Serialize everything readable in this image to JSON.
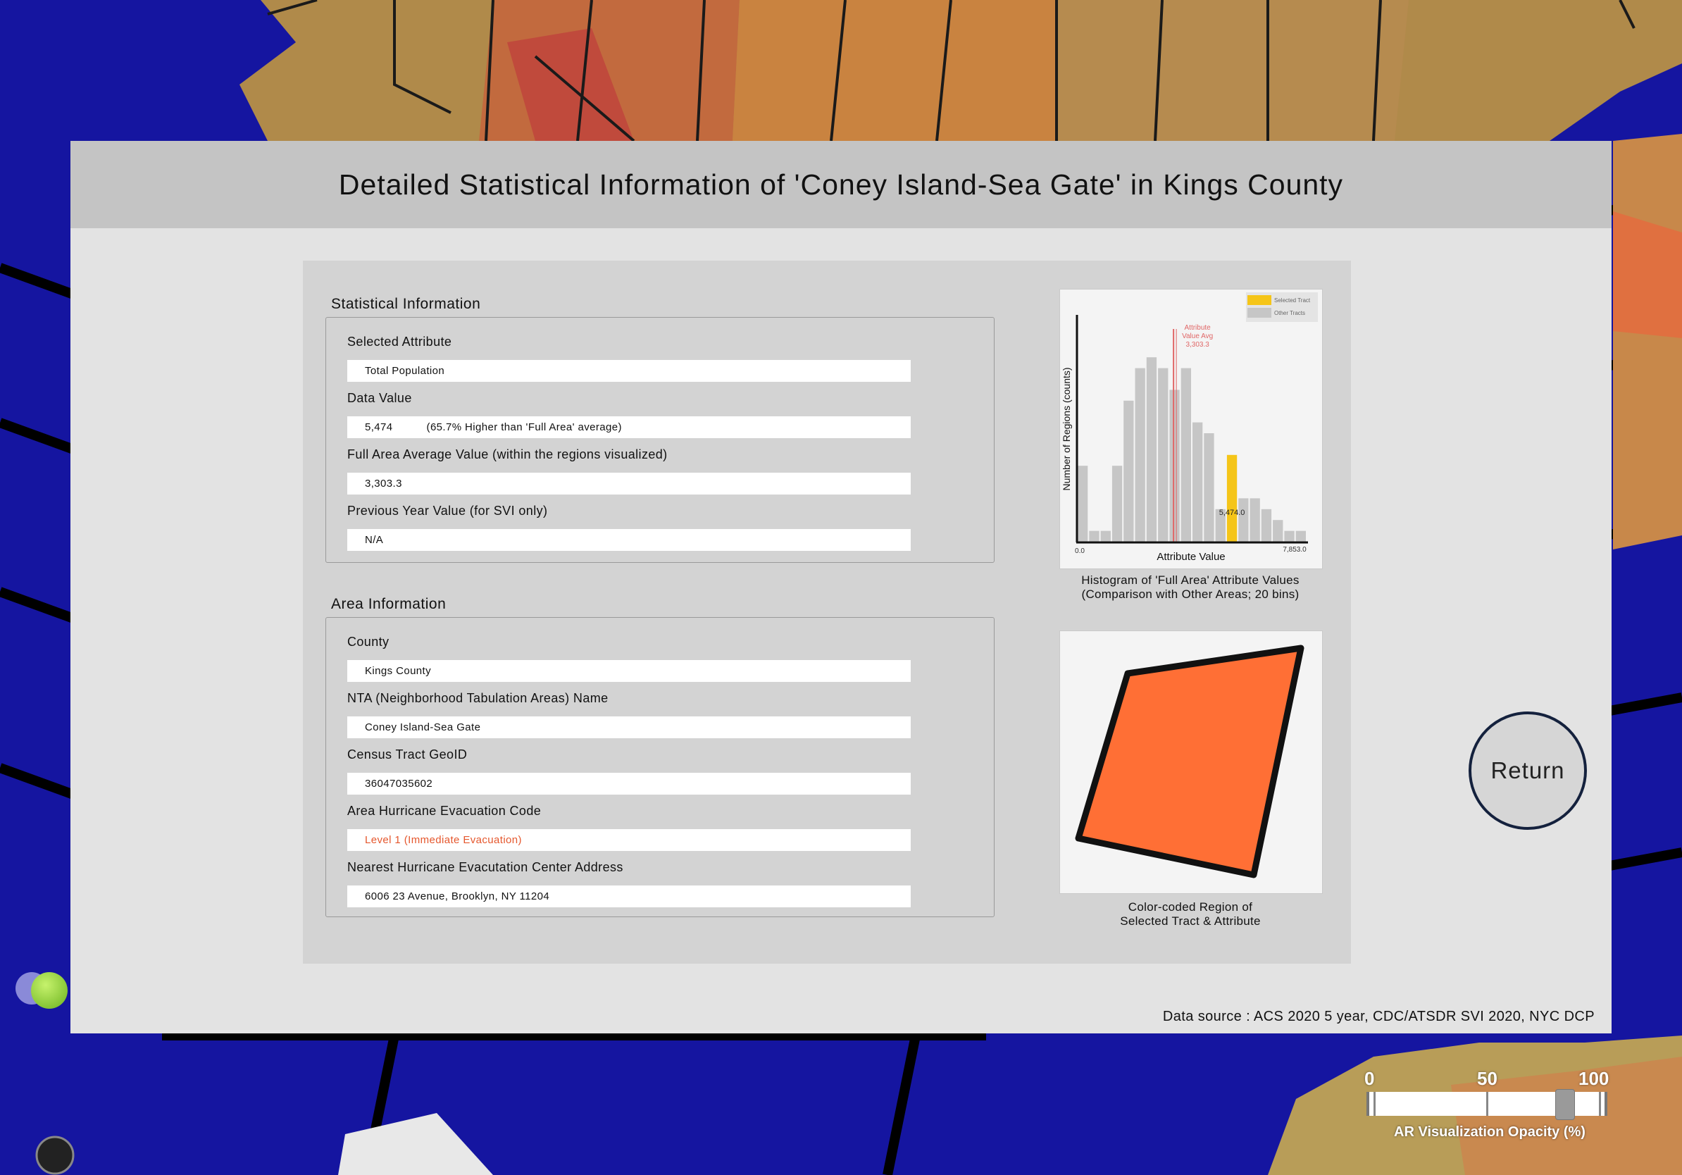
{
  "page_title": "Detailed Statistical Information of 'Coney Island-Sea Gate' in Kings County",
  "statistical_info": {
    "section_title": "Statistical Information",
    "fields": [
      {
        "label": "Selected Attribute",
        "value": "Total Population",
        "extra": ""
      },
      {
        "label": "Data Value",
        "value": "5,474",
        "extra": "(65.7% Higher than 'Full Area' average)"
      },
      {
        "label": "Full Area Average Value (within the regions visualized)",
        "value": "3,303.3",
        "extra": ""
      },
      {
        "label": "Previous Year Value (for SVI only)",
        "value": "N/A",
        "extra": ""
      }
    ]
  },
  "area_info": {
    "section_title": "Area Information",
    "fields": [
      {
        "label": "County",
        "value": "Kings County"
      },
      {
        "label": "NTA (Neighborhood Tabulation Areas) Name",
        "value": "Coney Island-Sea Gate"
      },
      {
        "label": "Census Tract GeoID",
        "value": "36047035602"
      },
      {
        "label": "Area Hurricane Evacuation Code",
        "value": "Level 1 (Immediate Evacuation)"
      },
      {
        "label": "Nearest Hurricane Evacutation Center Address",
        "value": "6006 23 Avenue, Brooklyn, NY 11204"
      }
    ]
  },
  "histogram_caption": [
    "Histogram of 'Full Area' Attribute Values",
    "(Comparison with Other Areas; 20 bins)"
  ],
  "region_caption": [
    "Color-coded Region of",
    "Selected Tract & Attribute"
  ],
  "return_label": "Return",
  "data_source": "Data source : ACS 2020 5 year, CDC/ATSDR SVI 2020, NYC DCP",
  "opacity_slider": {
    "label": "AR Visualization Opacity (%)",
    "tick_labels": [
      "0",
      "50",
      "100"
    ],
    "value_percent": 86
  },
  "colors": {
    "selected_bar": "#f5c518",
    "other_bar": "#c6c6c6",
    "avg_line": "#e06666",
    "region_fill": "#ff6f35",
    "evacuation_text": "#e5572d"
  },
  "chart_data": {
    "type": "bar",
    "ylabel": "Number of Regions (counts)",
    "xlabel": "Attribute Value",
    "x_min_label": "0.0",
    "x_max_label": "7,853.0",
    "xlim": [
      0,
      7853
    ],
    "legend": {
      "position": "top-right",
      "entries": [
        "Selected Tract",
        "Other Tracts"
      ]
    },
    "bins": 20,
    "values": [
      7,
      1,
      1,
      7,
      13,
      16,
      17,
      16,
      14,
      16,
      11,
      10,
      3,
      8,
      4,
      4,
      3,
      2,
      1,
      1
    ],
    "selected_bin": 13,
    "selected_label": "5,474.0",
    "average_value": 3303.3,
    "average_annotation": [
      "Attribute",
      "Value Avg",
      "3,303.3"
    ]
  }
}
